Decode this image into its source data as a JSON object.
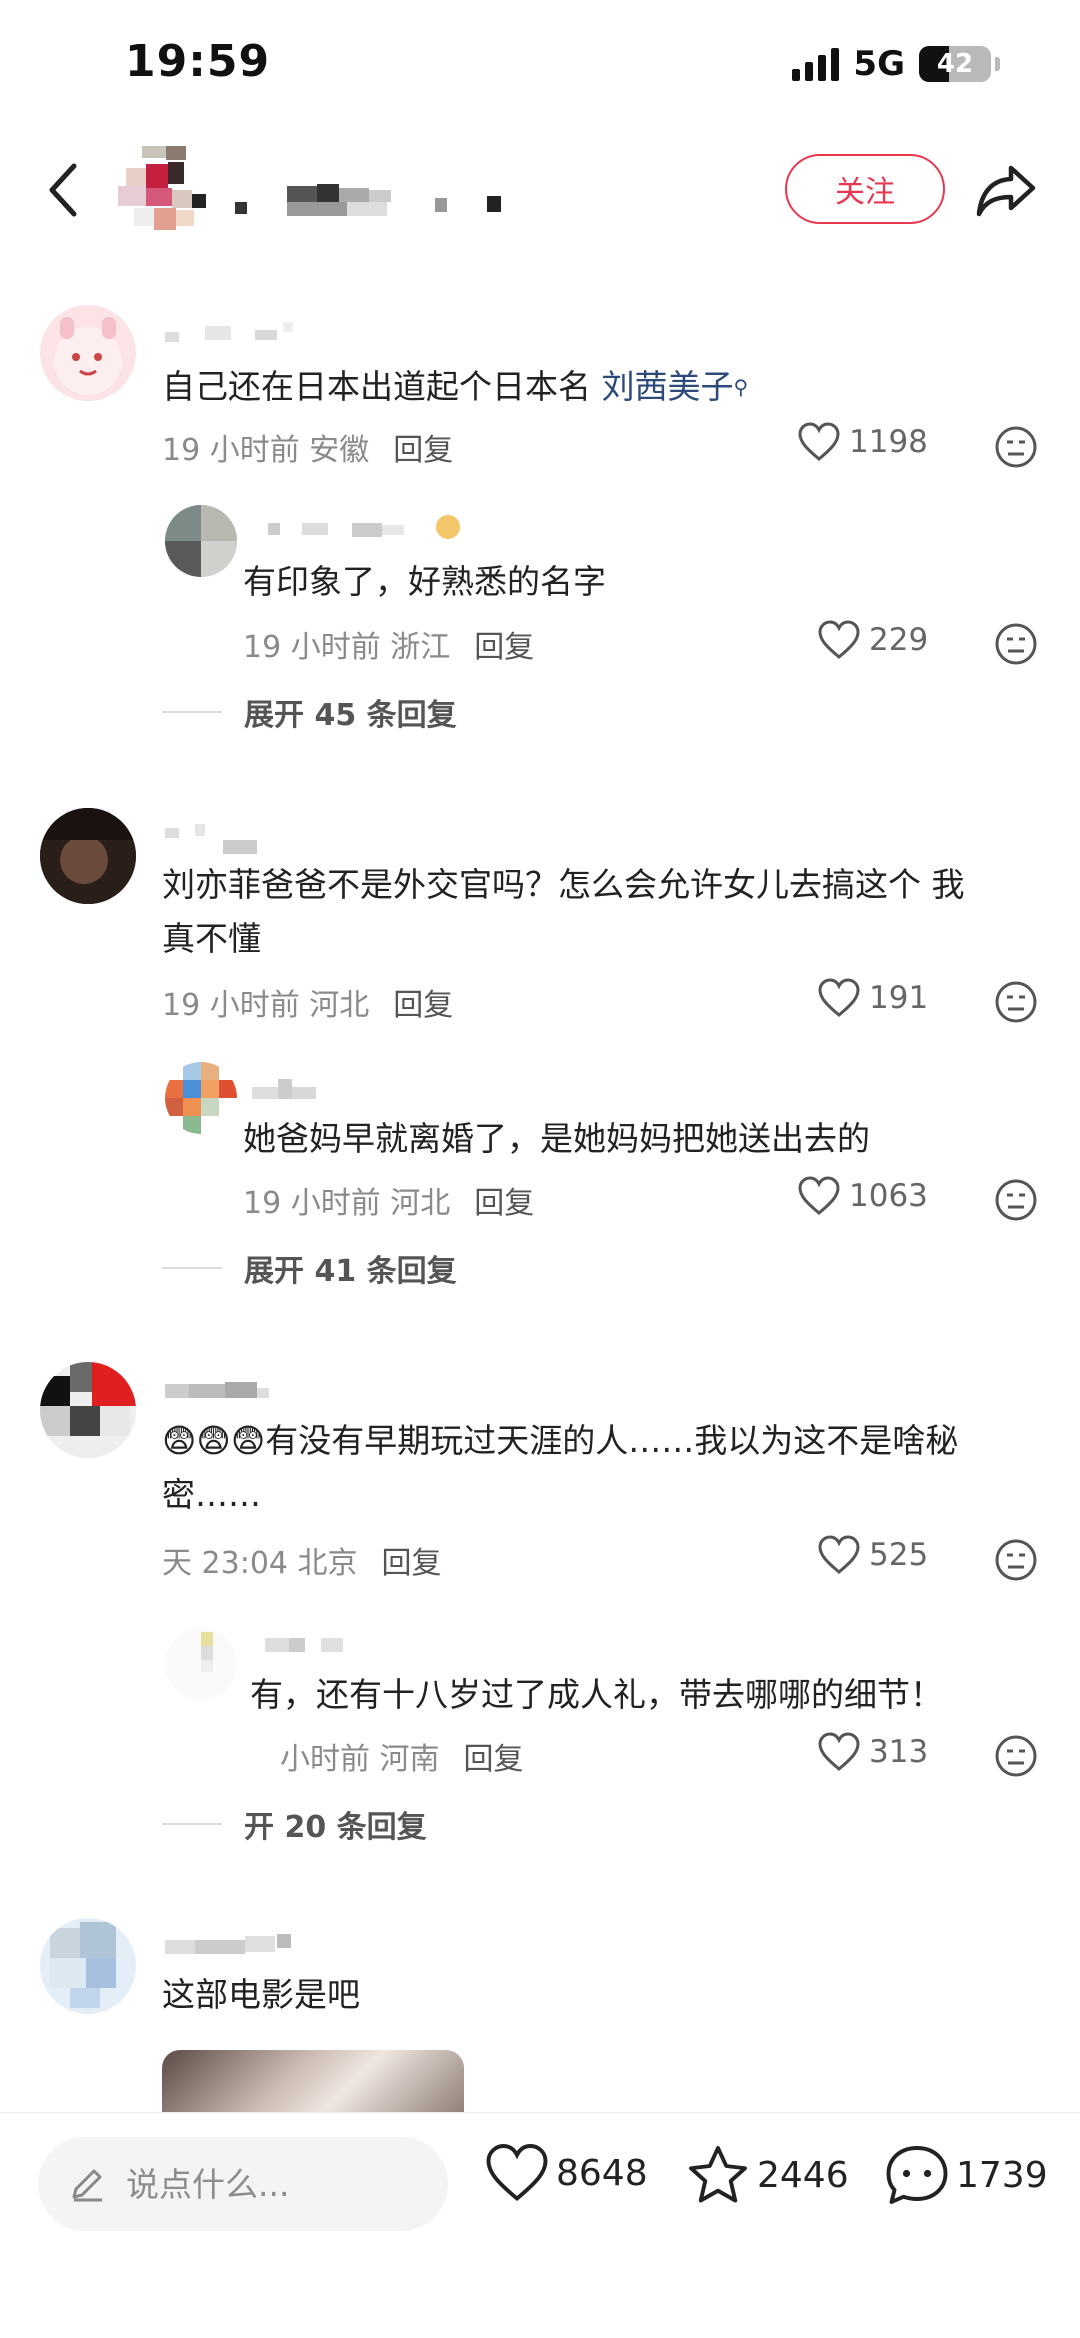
{
  "status": {
    "time": "19:59",
    "network": "5G",
    "battery": "42",
    "battery_level": 0.42
  },
  "header": {
    "follow_label": "关注"
  },
  "comments": [
    {
      "text_plain": "自己还在日本出道起个日本名 ",
      "text_link": "刘茜美子",
      "time": "19 小时前",
      "location": "安徽",
      "reply_label": "回复",
      "likes": "1198"
    },
    {
      "text": "有印象了，好熟悉的名字",
      "time": "19 小时前",
      "location": "浙江",
      "reply_label": "回复",
      "likes": "229"
    },
    {
      "expand": "展开 45 条回复"
    },
    {
      "text_line1": "刘亦菲爸爸不是外交官吗？怎么会允许女儿去搞这个 我",
      "text_line2": "真不懂",
      "time": "19 小时前",
      "location": "河北",
      "reply_label": "回复",
      "likes": "191"
    },
    {
      "text": "她爸妈早就离婚了，是她妈妈把她送出去的",
      "time": "19 小时前",
      "location": "河北",
      "reply_label": "回复",
      "likes": "1063"
    },
    {
      "expand": "展开 41 条回复"
    },
    {
      "text_line1": "有没有早期玩过天涯的人……我以为这不是啥秘",
      "text_line2": "密……",
      "time": "天 23:04",
      "location": "北京",
      "reply_label": "回复",
      "likes": "525"
    },
    {
      "text": "有，还有十八岁过了成人礼，带去哪哪的细节！",
      "time": "小时前",
      "location": "河南",
      "reply_label": "回复",
      "likes": "313"
    },
    {
      "expand": "开 20 条回复"
    },
    {
      "text": "这部电影是吧"
    }
  ],
  "bottom": {
    "placeholder": "说点什么...",
    "likes": "8648",
    "favorites": "2446",
    "comments": "1739"
  },
  "colors": {
    "accent": "#e8384f",
    "link": "#2d4a7a",
    "meta": "#8a8a8a"
  }
}
